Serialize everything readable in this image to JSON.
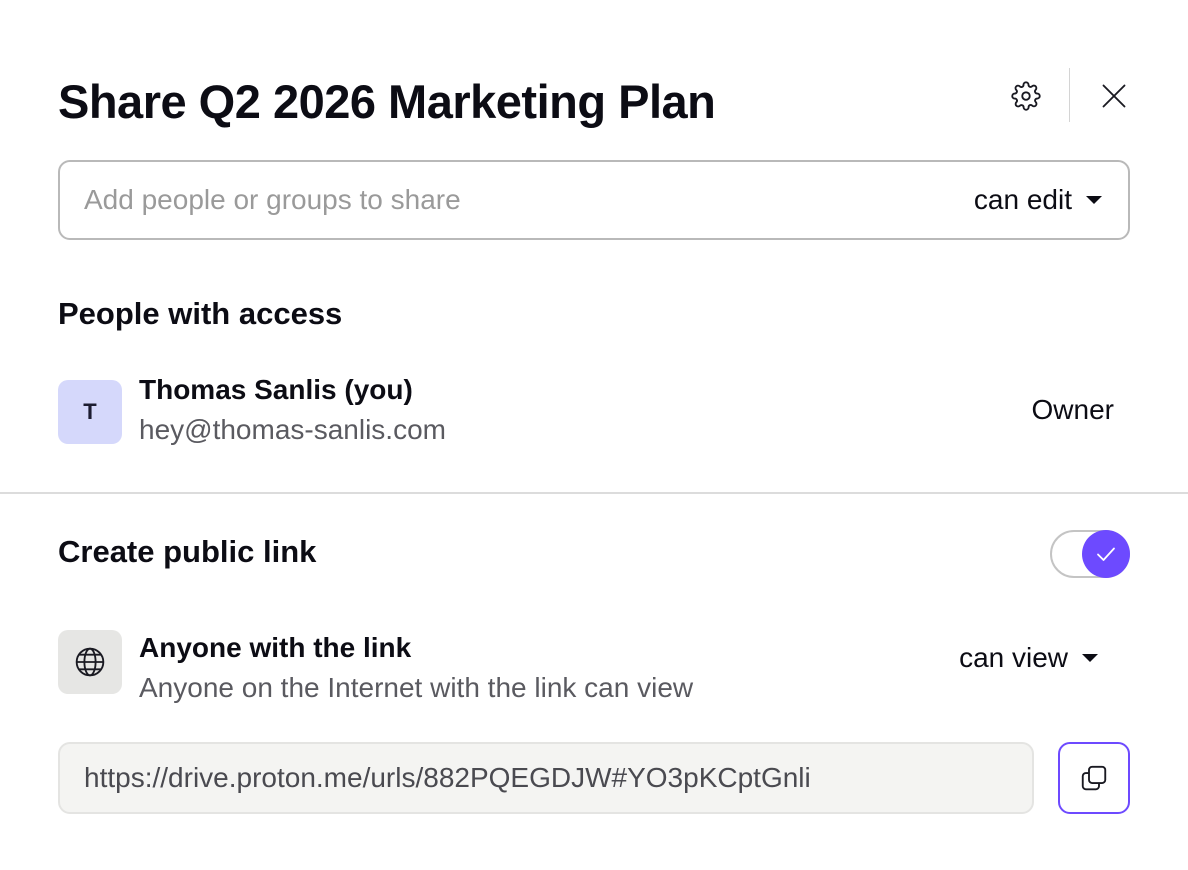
{
  "dialog": {
    "title": "Share Q2 2026 Marketing Plan"
  },
  "icons": {
    "settings": "gear-icon",
    "close": "close-icon",
    "dropdown": "chevron-down-icon",
    "toggle_check": "check-icon",
    "globe": "globe-icon",
    "copy": "copy-icon"
  },
  "share_input": {
    "placeholder": "Add people or groups to share",
    "value": "",
    "permission": "can edit"
  },
  "people_section": {
    "heading": "People with access",
    "members": [
      {
        "initial": "T",
        "name": "Thomas Sanlis (you)",
        "email": "hey@thomas-sanlis.com",
        "role": "Owner"
      }
    ]
  },
  "public_link": {
    "heading": "Create public link",
    "enabled": true,
    "audience_title": "Anyone with the link",
    "audience_description": "Anyone on the Internet with the link can view",
    "permission": "can view",
    "url": "https://drive.proton.me/urls/882PQEGDJW#YO3pKCptGnli"
  },
  "colors": {
    "accent": "#6d4aff",
    "avatar_bg": "#d5d8fb",
    "text_primary": "#0c0c14",
    "text_secondary": "#5a5a60",
    "url_field_bg": "#f4f4f2"
  }
}
